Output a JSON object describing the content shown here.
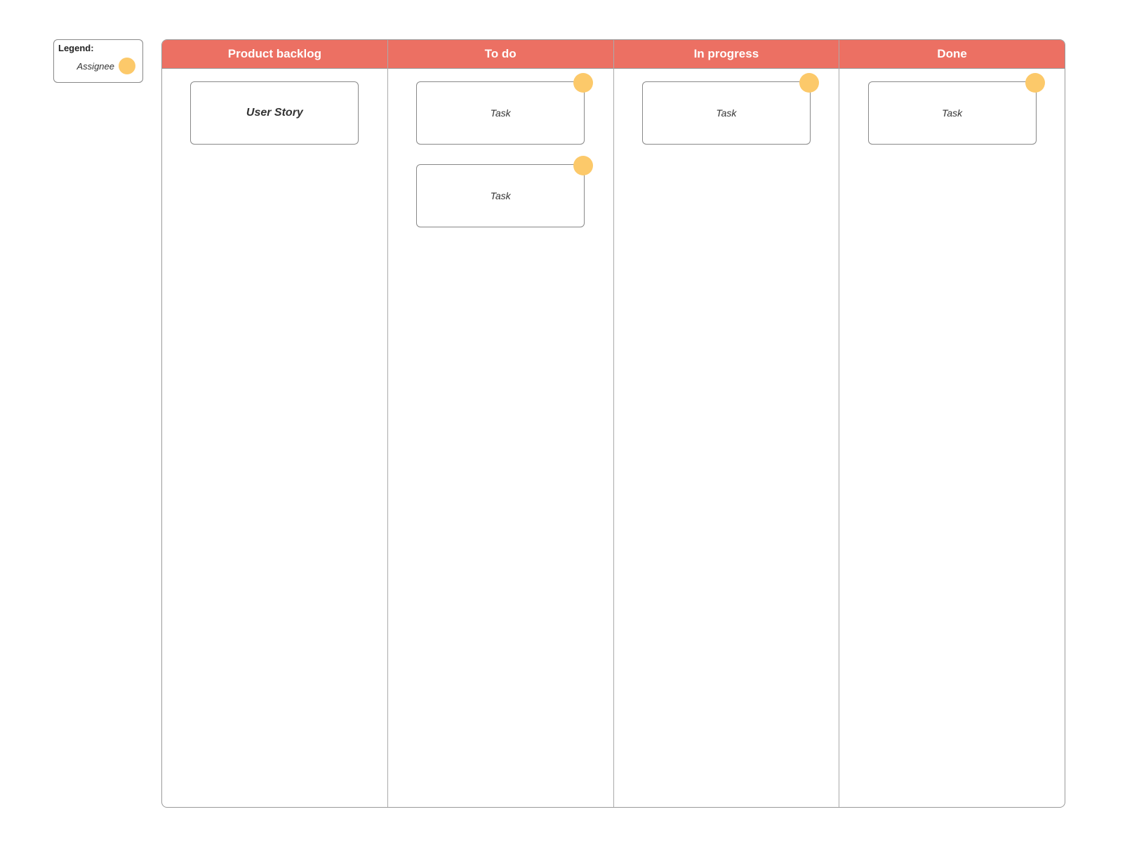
{
  "legend": {
    "title": "Legend:",
    "assignee_label": "Assignee"
  },
  "board": {
    "columns": [
      {
        "header": "Product backlog",
        "cards": [
          {
            "label": "User Story",
            "style": "story",
            "has_assignee": false
          }
        ]
      },
      {
        "header": "To do",
        "cards": [
          {
            "label": "Task",
            "style": "task",
            "has_assignee": true
          },
          {
            "label": "Task",
            "style": "task",
            "has_assignee": true
          }
        ]
      },
      {
        "header": "In progress",
        "cards": [
          {
            "label": "Task",
            "style": "task",
            "has_assignee": true
          }
        ]
      },
      {
        "header": "Done",
        "cards": [
          {
            "label": "Task",
            "style": "task",
            "has_assignee": true
          }
        ]
      }
    ]
  },
  "colors": {
    "header_bg": "#ec7063",
    "assignee_dot": "#fcc96a"
  }
}
